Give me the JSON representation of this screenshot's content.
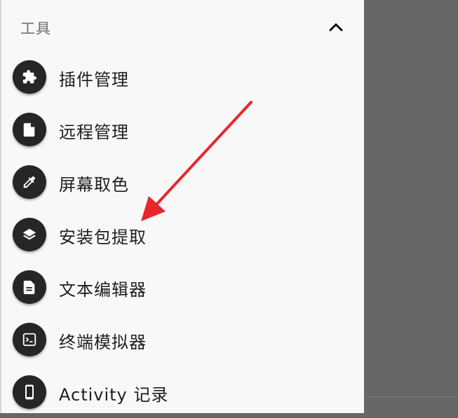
{
  "section": {
    "title": "工具",
    "collapse_icon": "chevron-up-icon"
  },
  "items": [
    {
      "label": "插件管理",
      "icon": "puzzle-icon"
    },
    {
      "label": "远程管理",
      "icon": "file-icon"
    },
    {
      "label": "屏幕取色",
      "icon": "eyedropper-icon"
    },
    {
      "label": "安装包提取",
      "icon": "layers-icon"
    },
    {
      "label": "文本编辑器",
      "icon": "document-icon"
    },
    {
      "label": "终端模拟器",
      "icon": "terminal-icon"
    },
    {
      "label": "Activity 记录",
      "icon": "phone-icon"
    }
  ],
  "colors": {
    "drawer_bg": "#f8f8f8",
    "scrim": "#666666",
    "icon_circle": "#262626",
    "annotation_arrow": "#e8262b"
  }
}
